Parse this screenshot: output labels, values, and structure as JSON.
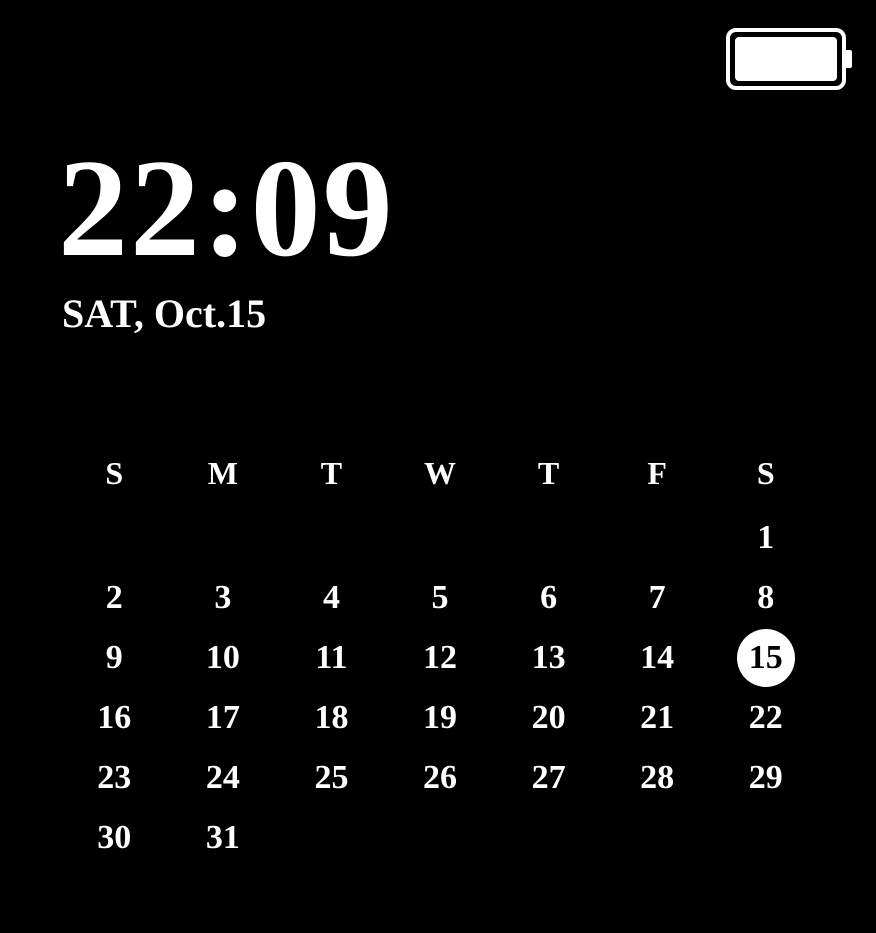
{
  "battery": {
    "level": 100
  },
  "clock": {
    "time": "22:09",
    "date": "SAT, Oct.15"
  },
  "calendar": {
    "weekdays": [
      "S",
      "M",
      "T",
      "W",
      "T",
      "F",
      "S"
    ],
    "weeks": [
      [
        "",
        "",
        "",
        "",
        "",
        "",
        "1"
      ],
      [
        "2",
        "3",
        "4",
        "5",
        "6",
        "7",
        "8"
      ],
      [
        "9",
        "10",
        "11",
        "12",
        "13",
        "14",
        "15"
      ],
      [
        "16",
        "17",
        "18",
        "19",
        "20",
        "21",
        "22"
      ],
      [
        "23",
        "24",
        "25",
        "26",
        "27",
        "28",
        "29"
      ],
      [
        "30",
        "31",
        "",
        "",
        "",
        "",
        ""
      ]
    ],
    "today": "15"
  }
}
